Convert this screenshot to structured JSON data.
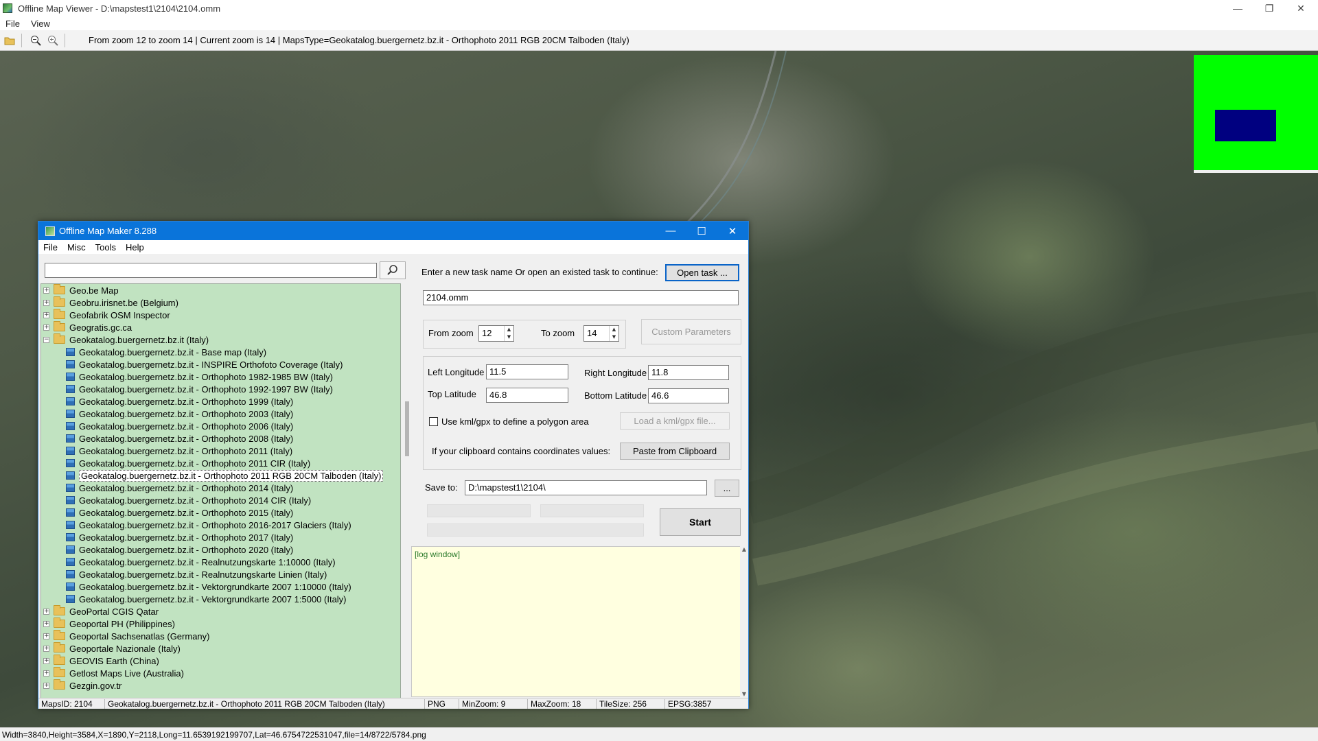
{
  "viewer": {
    "title": "Offline Map Viewer - D:\\mapstest1\\2104\\2104.omm",
    "menu": [
      "File",
      "View"
    ],
    "toolbar": {
      "info": "From zoom 12 to zoom 14   |   Current zoom is 14  |   MapsType=Geokatalog.buergernetz.bz.it - Orthophoto 2011 RGB 20CM Talboden (Italy)"
    },
    "status": "Width=3840,Height=3584,X=1890,Y=2118,Long=11.6539192199707,Lat=46.6754722531047,file=14/8722/5784.png",
    "colors": {
      "minimap_bg": "#00ff00",
      "minimap_viewport": "#000080"
    }
  },
  "dialog": {
    "title": "Offline Map Maker 8.288",
    "menu": [
      "File",
      "Misc",
      "Tools",
      "Help"
    ],
    "search": {
      "value": ""
    },
    "tree": [
      {
        "label": "Geo.be Map",
        "type": "folder",
        "expanded": false
      },
      {
        "label": "Geobru.irisnet.be (Belgium)",
        "type": "folder",
        "expanded": false
      },
      {
        "label": "Geofabrik OSM Inspector",
        "type": "folder",
        "expanded": false
      },
      {
        "label": "Geogratis.gc.ca",
        "type": "folder",
        "expanded": false
      },
      {
        "label": "Geokatalog.buergernetz.bz.it (Italy)",
        "type": "folder",
        "expanded": true
      },
      {
        "label": "Geokatalog.buergernetz.bz.it - Base map (Italy)",
        "type": "map"
      },
      {
        "label": "Geokatalog.buergernetz.bz.it - INSPIRE Orthofoto Coverage (Italy)",
        "type": "map"
      },
      {
        "label": "Geokatalog.buergernetz.bz.it - Orthophoto 1982-1985 BW (Italy)",
        "type": "map"
      },
      {
        "label": "Geokatalog.buergernetz.bz.it - Orthophoto 1992-1997 BW (Italy)",
        "type": "map"
      },
      {
        "label": "Geokatalog.buergernetz.bz.it - Orthophoto 1999 (Italy)",
        "type": "map"
      },
      {
        "label": "Geokatalog.buergernetz.bz.it - Orthophoto 2003 (Italy)",
        "type": "map"
      },
      {
        "label": "Geokatalog.buergernetz.bz.it - Orthophoto 2006 (Italy)",
        "type": "map"
      },
      {
        "label": "Geokatalog.buergernetz.bz.it - Orthophoto 2008 (Italy)",
        "type": "map"
      },
      {
        "label": "Geokatalog.buergernetz.bz.it - Orthophoto 2011 (Italy)",
        "type": "map"
      },
      {
        "label": "Geokatalog.buergernetz.bz.it - Orthophoto 2011 CIR (Italy)",
        "type": "map"
      },
      {
        "label": "Geokatalog.buergernetz.bz.it - Orthophoto 2011 RGB 20CM Talboden (Italy)",
        "type": "map",
        "selected": true
      },
      {
        "label": "Geokatalog.buergernetz.bz.it - Orthophoto 2014 (Italy)",
        "type": "map"
      },
      {
        "label": "Geokatalog.buergernetz.bz.it - Orthophoto 2014 CIR (Italy)",
        "type": "map"
      },
      {
        "label": "Geokatalog.buergernetz.bz.it - Orthophoto 2015 (Italy)",
        "type": "map"
      },
      {
        "label": "Geokatalog.buergernetz.bz.it - Orthophoto 2016-2017 Glaciers (Italy)",
        "type": "map"
      },
      {
        "label": "Geokatalog.buergernetz.bz.it - Orthophoto 2017 (Italy)",
        "type": "map"
      },
      {
        "label": "Geokatalog.buergernetz.bz.it - Orthophoto 2020 (Italy)",
        "type": "map"
      },
      {
        "label": "Geokatalog.buergernetz.bz.it - Realnutzungskarte 1:10000 (Italy)",
        "type": "map"
      },
      {
        "label": "Geokatalog.buergernetz.bz.it - Realnutzungskarte Linien (Italy)",
        "type": "map"
      },
      {
        "label": "Geokatalog.buergernetz.bz.it - Vektorgrundkarte 2007 1:10000 (Italy)",
        "type": "map"
      },
      {
        "label": "Geokatalog.buergernetz.bz.it - Vektorgrundkarte 2007 1:5000 (Italy)",
        "type": "map"
      },
      {
        "label": "GeoPortal CGIS Qatar",
        "type": "folder",
        "expanded": false
      },
      {
        "label": "Geoportal PH (Philippines)",
        "type": "folder",
        "expanded": false
      },
      {
        "label": "Geoportal Sachsenatlas (Germany)",
        "type": "folder",
        "expanded": false
      },
      {
        "label": "Geoportale Nazionale (Italy)",
        "type": "folder",
        "expanded": false
      },
      {
        "label": "GEOVIS Earth (China)",
        "type": "folder",
        "expanded": false
      },
      {
        "label": "Getlost Maps Live (Australia)",
        "type": "folder",
        "expanded": false
      },
      {
        "label": "Gezgin.gov.tr",
        "type": "folder",
        "expanded": false
      }
    ],
    "task_prompt": "Enter a new task name Or open an existed task to continue:",
    "open_task_label": "Open task ...",
    "task_name": "2104.omm",
    "from_zoom_label": "From zoom",
    "from_zoom": "12",
    "to_zoom_label": "To zoom",
    "to_zoom": "14",
    "custom_params_label": "Custom Parameters",
    "left_lon_label": "Left Longitude",
    "left_lon": "11.5",
    "right_lon_label": "Right Longitude",
    "right_lon": "11.8",
    "top_lat_label": "Top Latitude",
    "top_lat": "46.8",
    "bottom_lat_label": "Bottom Latitude",
    "bottom_lat": "46.6",
    "kml_label": "Use kml/gpx to define a polygon area",
    "kml_checked": false,
    "load_kml_label": "Load a kml/gpx file...",
    "clipboard_label": "If your clipboard contains coordinates values:",
    "paste_label": "Paste from Clipboard",
    "save_to_label": "Save to:",
    "save_to": "D:\\mapstest1\\2104\\",
    "browse_label": "...",
    "start_label": "Start",
    "log_text": "[log window]",
    "status": {
      "maps_id": "MapsID: 2104",
      "map_name": "Geokatalog.buergernetz.bz.it - Orthophoto 2011 RGB 20CM Talboden (Italy)",
      "format": "PNG",
      "min_zoom": "MinZoom: 9",
      "max_zoom": "MaxZoom: 18",
      "tile_size": "TileSize: 256",
      "epsg": "EPSG:3857"
    }
  }
}
